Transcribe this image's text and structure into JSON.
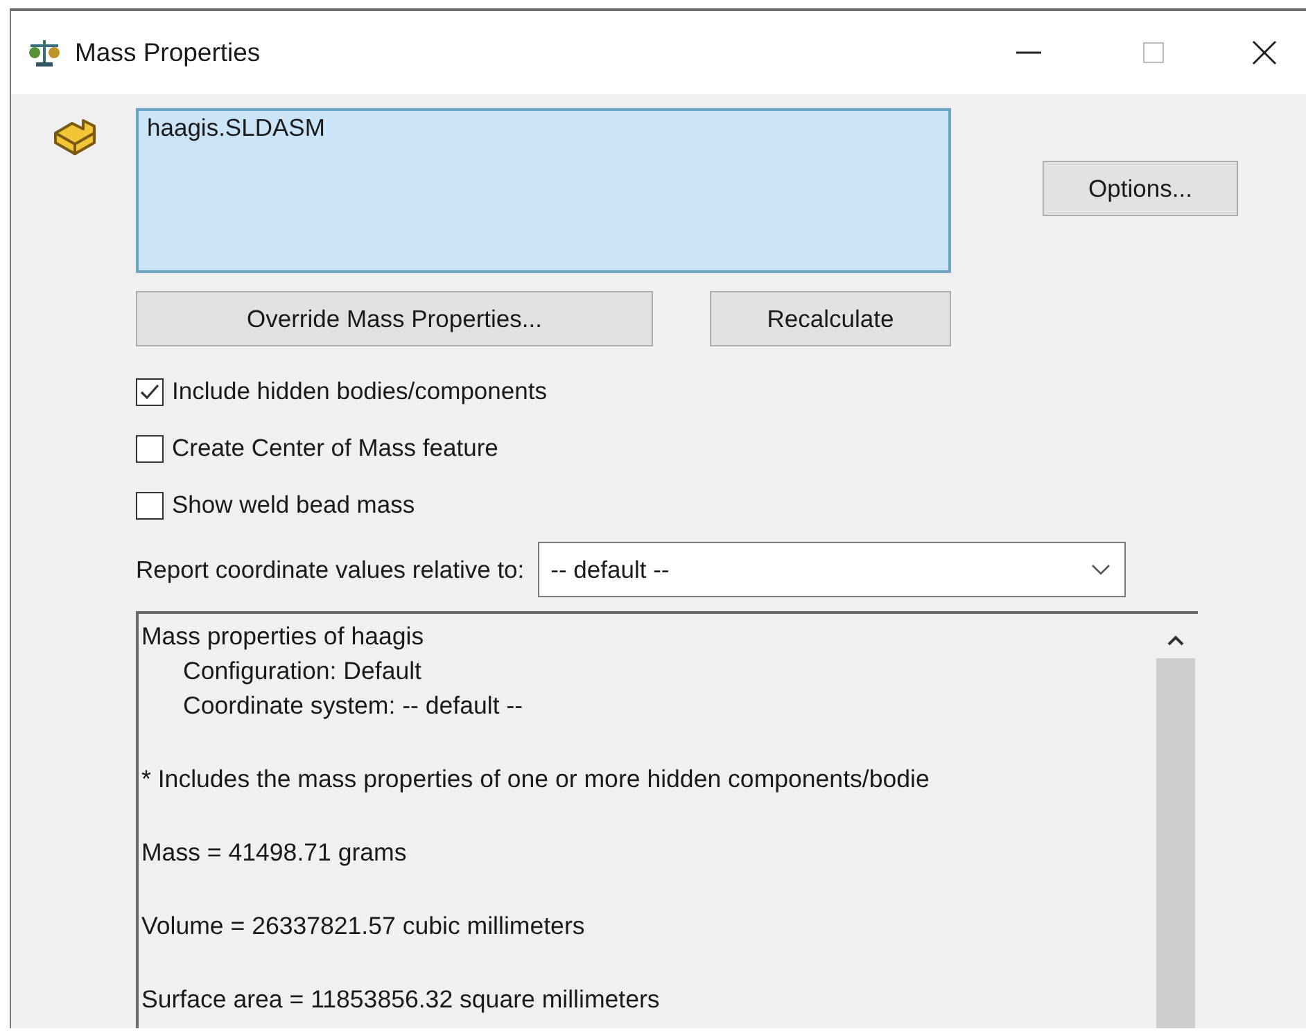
{
  "window": {
    "title": "Mass Properties"
  },
  "selection": {
    "items": [
      "haagis.SLDASM"
    ]
  },
  "buttons": {
    "options": "Options...",
    "override": "Override Mass Properties...",
    "recalculate": "Recalculate"
  },
  "options": [
    {
      "label": "Include hidden bodies/components",
      "checked": true
    },
    {
      "label": "Create Center of Mass feature",
      "checked": false
    },
    {
      "label": "Show weld bead mass",
      "checked": false
    }
  ],
  "coordinate": {
    "label": "Report coordinate values relative to:",
    "value": "-- default --"
  },
  "report": [
    {
      "kind": "header",
      "text": "Mass properties of haagis"
    },
    {
      "kind": "sub",
      "text": "Configuration: Default"
    },
    {
      "kind": "sub",
      "text": "Coordinate system: -- default --"
    },
    {
      "kind": "entry",
      "text": "* Includes the mass properties of one or more hidden components/bodie"
    },
    {
      "kind": "entry",
      "text": "Mass = 41498.71 grams"
    },
    {
      "kind": "entry",
      "text": "Volume = 26337821.57 cubic millimeters"
    },
    {
      "kind": "entry",
      "text": "Surface area = 11853856.32  square millimeters"
    }
  ]
}
